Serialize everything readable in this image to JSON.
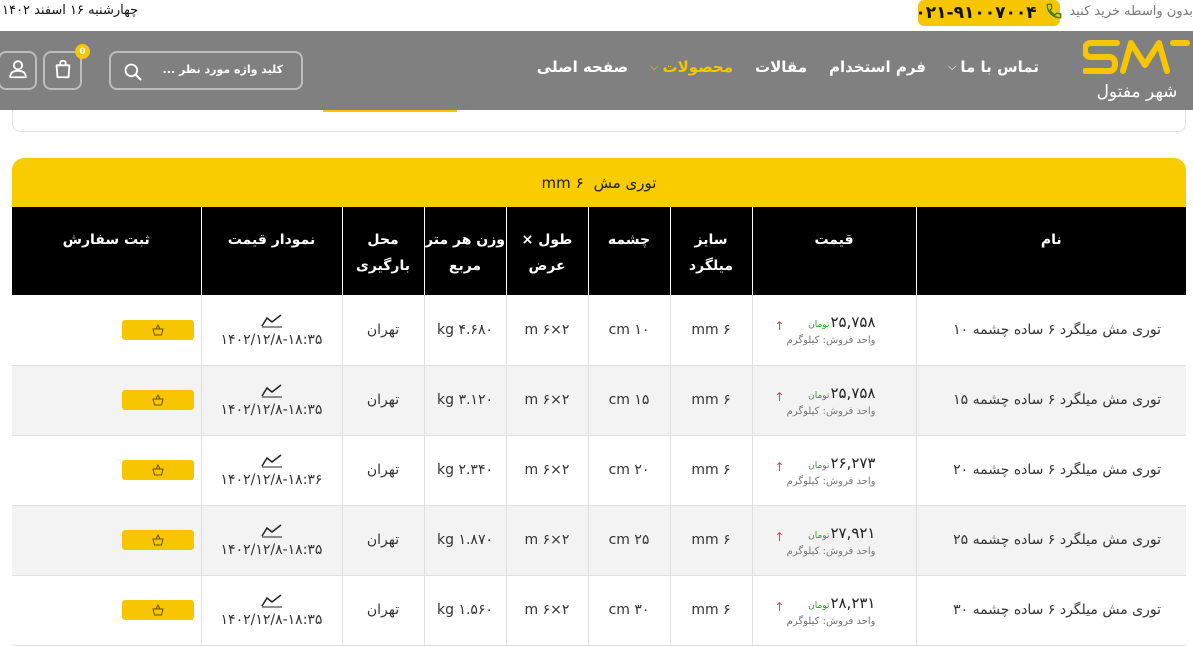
{
  "topbar": {
    "date": "چهارشنبه ۱۶ اسفند ۱۴۰۲",
    "buy_text": "بدون واسطه خرید کنید",
    "phone": "۰۲۱-۹۱۰۰۷۰۰۴",
    "phone_icon": "phone-icon"
  },
  "navbar": {
    "logo_text": "SM",
    "logo_subtitle": "شهر مفتول",
    "menu": [
      {
        "label": "صفحه اصلی",
        "active": false
      },
      {
        "label": "محصولات",
        "active": true,
        "dropdown": true
      },
      {
        "label": "مقالات",
        "active": false
      },
      {
        "label": "فرم استخدام",
        "active": false
      },
      {
        "label": "تماس با ما",
        "active": false,
        "dropdown": true
      }
    ],
    "search_placeholder": "کلید واژه مورد نظر ...",
    "search_icon": "search-icon",
    "cart_icon": "cart-icon",
    "cart_count": "0",
    "user_icon": "user-icon",
    "accent_color": "#f7c600",
    "bar_color": "#808080"
  },
  "section": {
    "title_main": "توری مش",
    "title_size": "۶ mm"
  },
  "table": {
    "headers": [
      "نام",
      "قیمت",
      "سایز میلگرد",
      "چشمه",
      "طول × عرض",
      "وزن هر متر مربع",
      "محل بارگیری",
      "نمودار قیمت",
      "ثبت سفارش"
    ],
    "rows": [
      {
        "name": "توری مش میلگرد ۶ ساده چشمه ۱۰",
        "price": "۲۵,۷۵۸",
        "currency": "تومان",
        "unit": "واحد فروش: کیلوگرم",
        "rebar": "۶ mm",
        "mesh": "۱۰ cm",
        "dims": "۲×۶ m",
        "weight": "۴.۶۸۰ kg",
        "location": "تهران",
        "updated": "۱۴۰۲/۱۲/۸-۱۸:۳۵"
      },
      {
        "name": "توری مش میلگرد ۶ ساده چشمه ۱۵",
        "price": "۲۵,۷۵۸",
        "currency": "تومان",
        "unit": "واحد فروش: کیلوگرم",
        "rebar": "۶ mm",
        "mesh": "۱۵ cm",
        "dims": "۲×۶ m",
        "weight": "۳.۱۲۰ kg",
        "location": "تهران",
        "updated": "۱۴۰۲/۱۲/۸-۱۸:۳۵"
      },
      {
        "name": "توری مش میلگرد ۶ ساده چشمه ۲۰",
        "price": "۲۶,۲۷۳",
        "currency": "تومان",
        "unit": "واحد فروش: کیلوگرم",
        "rebar": "۶ mm",
        "mesh": "۲۰ cm",
        "dims": "۲×۶ m",
        "weight": "۲.۳۴۰ kg",
        "location": "تهران",
        "updated": "۱۴۰۲/۱۲/۸-۱۸:۳۶"
      },
      {
        "name": "توری مش میلگرد ۶ ساده چشمه ۲۵",
        "price": "۲۷,۹۲۱",
        "currency": "تومان",
        "unit": "واحد فروش: کیلوگرم",
        "rebar": "۶ mm",
        "mesh": "۲۵ cm",
        "dims": "۲×۶ m",
        "weight": "۱.۸۷۰ kg",
        "location": "تهران",
        "updated": "۱۴۰۲/۱۲/۸-۱۸:۳۵"
      },
      {
        "name": "توری مش میلگرد ۶ ساده چشمه ۳۰",
        "price": "۲۸,۲۳۱",
        "currency": "تومان",
        "unit": "واحد فروش: کیلوگرم",
        "rebar": "۶ mm",
        "mesh": "۳۰ cm",
        "dims": "۲×۶ m",
        "weight": "۱.۵۶۰ kg",
        "location": "تهران",
        "updated": "۱۴۰۲/۱۲/۸-۱۸:۳۵"
      }
    ],
    "chart_icon": "line-chart-icon",
    "order_icon": "basket-icon",
    "price_trend_icon": "arrow-up-icon"
  }
}
